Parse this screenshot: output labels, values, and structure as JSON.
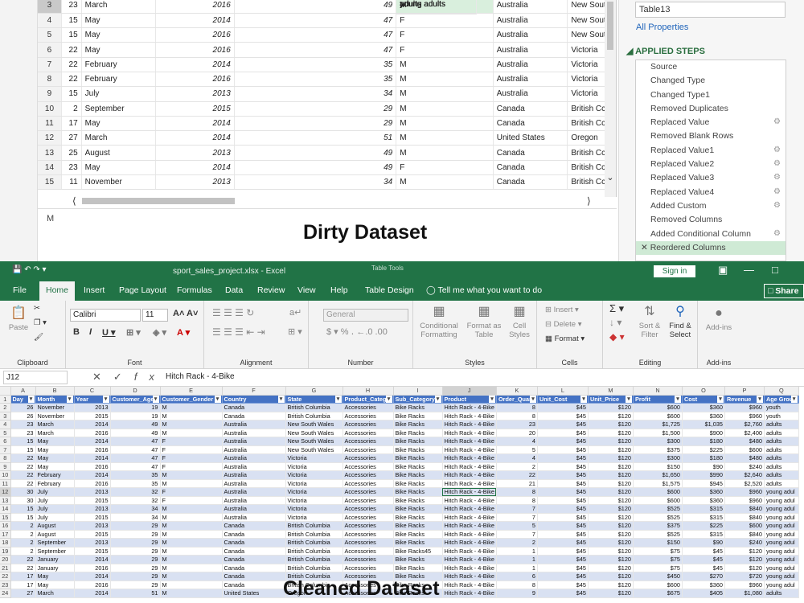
{
  "dirty": {
    "rows": [
      {
        "n": "3",
        "day": "23",
        "month": "March",
        "year": "2016",
        "age": "49",
        "group": "adults",
        "gender": "M",
        "country": "Australia",
        "state": "New Sout"
      },
      {
        "n": "4",
        "day": "15",
        "month": "May",
        "year": "2014",
        "age": "47",
        "group": "adults",
        "gender": "F",
        "country": "Australia",
        "state": "New Sout"
      },
      {
        "n": "5",
        "day": "15",
        "month": "May",
        "year": "2016",
        "age": "47",
        "group": "adults",
        "gender": "F",
        "country": "Australia",
        "state": "New Sout"
      },
      {
        "n": "6",
        "day": "22",
        "month": "May",
        "year": "2016",
        "age": "47",
        "group": "adults",
        "gender": "F",
        "country": "Australia",
        "state": "Victoria"
      },
      {
        "n": "7",
        "day": "22",
        "month": "February",
        "year": "2014",
        "age": "35",
        "group": "adults",
        "gender": "M",
        "country": "Australia",
        "state": "Victoria"
      },
      {
        "n": "8",
        "day": "22",
        "month": "February",
        "year": "2016",
        "age": "35",
        "group": "adults",
        "gender": "M",
        "country": "Australia",
        "state": "Victoria"
      },
      {
        "n": "9",
        "day": "15",
        "month": "July",
        "year": "2013",
        "age": "34",
        "group": "young adults",
        "gender": "M",
        "country": "Australia",
        "state": "Victoria"
      },
      {
        "n": "10",
        "day": "2",
        "month": "September",
        "year": "2015",
        "age": "29",
        "group": "young adults",
        "gender": "M",
        "country": "Canada",
        "state": "British Cc"
      },
      {
        "n": "11",
        "day": "17",
        "month": "May",
        "year": "2014",
        "age": "29",
        "group": "young adults",
        "gender": "M",
        "country": "Canada",
        "state": "British Cc"
      },
      {
        "n": "12",
        "day": "27",
        "month": "March",
        "year": "2014",
        "age": "51",
        "group": "adults",
        "gender": "M",
        "country": "United States",
        "state": "Oregon"
      },
      {
        "n": "13",
        "day": "25",
        "month": "August",
        "year": "2013",
        "age": "49",
        "group": "adults",
        "gender": "M",
        "country": "Canada",
        "state": "British Cc"
      },
      {
        "n": "14",
        "day": "23",
        "month": "May",
        "year": "2014",
        "age": "49",
        "group": "adults",
        "gender": "F",
        "country": "Canada",
        "state": "British Cc"
      },
      {
        "n": "15",
        "day": "11",
        "month": "November",
        "year": "2013",
        "age": "34",
        "group": "young adults",
        "gender": "M",
        "country": "Canada",
        "state": "British Cc"
      }
    ],
    "formula_text": "M",
    "title": "Dirty Dataset",
    "table_name": "Table13",
    "all_properties": "All Properties",
    "applied_steps_label": "APPLIED STEPS",
    "steps": [
      {
        "label": "Source",
        "gear": false
      },
      {
        "label": "Changed Type",
        "gear": false
      },
      {
        "label": "Changed Type1",
        "gear": false
      },
      {
        "label": "Removed Duplicates",
        "gear": false
      },
      {
        "label": "Replaced Value",
        "gear": true
      },
      {
        "label": "Removed Blank Rows",
        "gear": false
      },
      {
        "label": "Replaced Value1",
        "gear": true
      },
      {
        "label": "Replaced Value2",
        "gear": true
      },
      {
        "label": "Replaced Value3",
        "gear": true
      },
      {
        "label": "Replaced Value4",
        "gear": true
      },
      {
        "label": "Added Custom",
        "gear": true
      },
      {
        "label": "Removed Columns",
        "gear": false
      },
      {
        "label": "Added Conditional Column",
        "gear": true
      },
      {
        "label": "Reordered Columns",
        "gear": false,
        "active": true
      }
    ]
  },
  "excel": {
    "file_title": "sport_sales_project.xlsx  -  Excel",
    "table_tools": "Table Tools",
    "sign_in": "Sign in",
    "tabs": [
      "File",
      "Home",
      "Insert",
      "Page Layout",
      "Formulas",
      "Data",
      "Review",
      "View",
      "Help",
      "Table Design"
    ],
    "active_tab": "Home",
    "tell_me": "Tell me what you want to do",
    "share": "Share",
    "ribbon": {
      "clipboard": {
        "label": "Clipboard",
        "paste": "Paste"
      },
      "font": {
        "label": "Font",
        "name": "Calibri",
        "size": "11"
      },
      "alignment": {
        "label": "Alignment"
      },
      "number": {
        "label": "Number",
        "format": "General"
      },
      "styles": {
        "label": "Styles",
        "conditional": "Conditional Formatting",
        "format_table": "Format as Table",
        "cell_styles": "Cell Styles"
      },
      "cells": {
        "label": "Cells",
        "insert": "Insert",
        "delete": "Delete",
        "format": "Format"
      },
      "editing": {
        "label": "Editing",
        "sort": "Sort & Filter",
        "find": "Find & Select"
      },
      "addins": {
        "label": "Add-ins",
        "btn": "Add-ins"
      }
    },
    "name_box": "J12",
    "formula_value": "Hitch Rack - 4-Bike",
    "columns": [
      "A",
      "B",
      "C",
      "D",
      "E",
      "F",
      "G",
      "H",
      "I",
      "J",
      "K",
      "L",
      "M",
      "N",
      "O",
      "P",
      "Q"
    ],
    "headers": [
      "Day",
      "Month",
      "Year",
      "Customer_Age",
      "Customer_Gender",
      "Country",
      "State",
      "Product_Catego",
      "Sub_Category",
      "Product",
      "Order_Quan",
      "Unit_Cost",
      "Unit_Price",
      "Profit",
      "Cost",
      "Revenue",
      "Age Group"
    ],
    "rows": [
      [
        "26",
        "November",
        "2013",
        "19",
        "M",
        "Canada",
        "British Columbia",
        "Accessories",
        "Bike Racks",
        "Hitch Rack - 4-Bike",
        "8",
        "$45",
        "$120",
        "$600",
        "$360",
        "$960",
        "youth"
      ],
      [
        "26",
        "November",
        "2015",
        "19",
        "M",
        "Canada",
        "British Columbia",
        "Accessories",
        "Bike Racks",
        "Hitch Rack - 4-Bike",
        "8",
        "$45",
        "$120",
        "$600",
        "$360",
        "$960",
        "youth"
      ],
      [
        "23",
        "March",
        "2014",
        "49",
        "M",
        "Australia",
        "New South Wales",
        "Accessories",
        "Bike Racks",
        "Hitch Rack - 4-Bike",
        "23",
        "$45",
        "$120",
        "$1,725",
        "$1,035",
        "$2,760",
        "adults"
      ],
      [
        "23",
        "March",
        "2016",
        "49",
        "M",
        "Australia",
        "New South Wales",
        "Accessories",
        "Bike Racks",
        "Hitch Rack - 4-Bike",
        "20",
        "$45",
        "$120",
        "$1,500",
        "$900",
        "$2,400",
        "adults"
      ],
      [
        "15",
        "May",
        "2014",
        "47",
        "F",
        "Australia",
        "New South Wales",
        "Accessories",
        "Bike Racks",
        "Hitch Rack - 4-Bike",
        "4",
        "$45",
        "$120",
        "$300",
        "$180",
        "$480",
        "adults"
      ],
      [
        "15",
        "May",
        "2016",
        "47",
        "F",
        "Australia",
        "New South Wales",
        "Accessories",
        "Bike Racks",
        "Hitch Rack - 4-Bike",
        "5",
        "$45",
        "$120",
        "$375",
        "$225",
        "$600",
        "adults"
      ],
      [
        "22",
        "May",
        "2014",
        "47",
        "F",
        "Australia",
        "Victoria",
        "Accessories",
        "Bike Racks",
        "Hitch Rack - 4-Bike",
        "4",
        "$45",
        "$120",
        "$300",
        "$180",
        "$480",
        "adults"
      ],
      [
        "22",
        "May",
        "2016",
        "47",
        "F",
        "Australia",
        "Victoria",
        "Accessories",
        "Bike Racks",
        "Hitch Rack - 4-Bike",
        "2",
        "$45",
        "$120",
        "$150",
        "$90",
        "$240",
        "adults"
      ],
      [
        "22",
        "February",
        "2014",
        "35",
        "M",
        "Australia",
        "Victoria",
        "Accessories",
        "Bike Racks",
        "Hitch Rack - 4-Bike",
        "22",
        "$45",
        "$120",
        "$1,650",
        "$990",
        "$2,640",
        "adults"
      ],
      [
        "22",
        "February",
        "2016",
        "35",
        "M",
        "Australia",
        "Victoria",
        "Accessories",
        "Bike Racks",
        "Hitch Rack - 4-Bike",
        "21",
        "$45",
        "$120",
        "$1,575",
        "$945",
        "$2,520",
        "adults"
      ],
      [
        "30",
        "July",
        "2013",
        "32",
        "F",
        "Australia",
        "Victoria",
        "Accessories",
        "Bike Racks",
        "Hitch Rack - 4-Bike",
        "8",
        "$45",
        "$120",
        "$600",
        "$360",
        "$960",
        "young adul"
      ],
      [
        "30",
        "July",
        "2015",
        "32",
        "F",
        "Australia",
        "Victoria",
        "Accessories",
        "Bike Racks",
        "Hitch Rack - 4-Bike",
        "8",
        "$45",
        "$120",
        "$600",
        "$360",
        "$960",
        "young adul"
      ],
      [
        "15",
        "July",
        "2013",
        "34",
        "M",
        "Australia",
        "Victoria",
        "Accessories",
        "Bike Racks",
        "Hitch Rack - 4-Bike",
        "7",
        "$45",
        "$120",
        "$525",
        "$315",
        "$840",
        "young adul"
      ],
      [
        "15",
        "July",
        "2015",
        "34",
        "M",
        "Australia",
        "Victoria",
        "Accessories",
        "Bike Racks",
        "Hitch Rack - 4-Bike",
        "7",
        "$45",
        "$120",
        "$525",
        "$315",
        "$840",
        "young adul"
      ],
      [
        "2",
        "August",
        "2013",
        "29",
        "M",
        "Canada",
        "British Columbia",
        "Accessories",
        "Bike Racks",
        "Hitch Rack - 4-Bike",
        "5",
        "$45",
        "$120",
        "$375",
        "$225",
        "$600",
        "young adul"
      ],
      [
        "2",
        "August",
        "2015",
        "29",
        "M",
        "Canada",
        "British Columbia",
        "Accessories",
        "Bike Racks",
        "Hitch Rack - 4-Bike",
        "7",
        "$45",
        "$120",
        "$525",
        "$315",
        "$840",
        "young adul"
      ],
      [
        "2",
        "September",
        "2013",
        "29",
        "M",
        "Canada",
        "British Columbia",
        "Accessories",
        "Bike Racks",
        "Hitch Rack - 4-Bike",
        "2",
        "$45",
        "$120",
        "$150",
        "$90",
        "$240",
        "young adul"
      ],
      [
        "2",
        "September",
        "2015",
        "29",
        "M",
        "Canada",
        "British Columbia",
        "Accessories",
        "Bike Racks45",
        "Hitch Rack - 4-Bike",
        "1",
        "$45",
        "$120",
        "$75",
        "$45",
        "$120",
        "young adul"
      ],
      [
        "22",
        "January",
        "2014",
        "29",
        "M",
        "Canada",
        "British Columbia",
        "Accessories",
        "Bike Racks",
        "Hitch Rack - 4-Bike",
        "1",
        "$45",
        "$120",
        "$75",
        "$45",
        "$120",
        "young adul"
      ],
      [
        "22",
        "January",
        "2016",
        "29",
        "M",
        "Canada",
        "British Columbia",
        "Accessories",
        "Bike Racks",
        "Hitch Rack - 4-Bike",
        "1",
        "$45",
        "$120",
        "$75",
        "$45",
        "$120",
        "young adul"
      ],
      [
        "17",
        "May",
        "2014",
        "29",
        "M",
        "Canada",
        "British Columbia",
        "Accessories",
        "Bike Racks",
        "Hitch Rack - 4-Bike",
        "6",
        "$45",
        "$120",
        "$450",
        "$270",
        "$720",
        "young adul"
      ],
      [
        "17",
        "May",
        "2016",
        "29",
        "M",
        "Canada",
        "British Columbia",
        "Accessories",
        "Bike Racks",
        "Hitch Rack - 4-Bike",
        "8",
        "$45",
        "$120",
        "$600",
        "$360",
        "$960",
        "young adul"
      ],
      [
        "27",
        "March",
        "2014",
        "51",
        "M",
        "United States",
        "Oregon",
        "Accessories",
        "Bike Racks",
        "Hitch Rack - 4-Bike",
        "9",
        "$45",
        "$120",
        "$675",
        "$405",
        "$1,080",
        "adults"
      ]
    ],
    "title": "Cleaned Dataset"
  }
}
